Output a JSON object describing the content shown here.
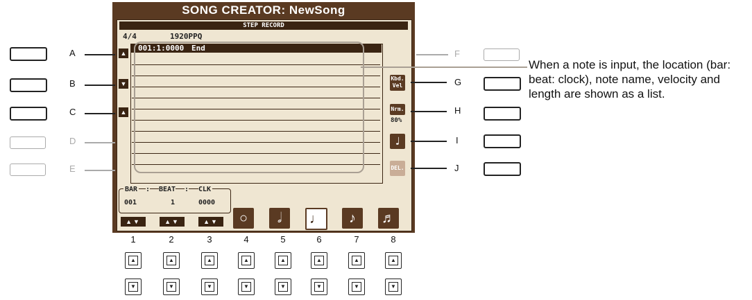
{
  "screen": {
    "title": "SONG CREATOR: NewSong",
    "subtitle": "STEP RECORD",
    "time_signature": "4/4",
    "resolution": "1920PPQ",
    "list_first_location": "001:1:0000",
    "list_first_event": "End"
  },
  "position": {
    "bar_label": "BAR",
    "beat_label": "BEAT",
    "clk_label": "CLK",
    "separator": ":",
    "bar_value": "001",
    "beat_value": "1",
    "clk_value": "0000"
  },
  "right_icons": {
    "kbd_vel_line1": "Kbd.",
    "kbd_vel_line2": "Vel",
    "normal_line1": "Nrm.",
    "normal_percent": "80%",
    "delete": "DEL."
  },
  "left_labels": [
    "A",
    "B",
    "C",
    "D",
    "E"
  ],
  "right_labels": [
    "F",
    "G",
    "H",
    "I",
    "J"
  ],
  "numbers": [
    "1",
    "2",
    "3",
    "4",
    "5",
    "6",
    "7",
    "8"
  ],
  "callout": "When a note is input, the location (bar: beat: clock), note name, velocity and length are shown as a list.",
  "note_lengths": [
    "whole-note-icon",
    "half-note-icon",
    "quarter-note-icon",
    "eighth-note-icon",
    "sixteenth-note-icon"
  ],
  "selected_note_length": "quarter-note-icon"
}
